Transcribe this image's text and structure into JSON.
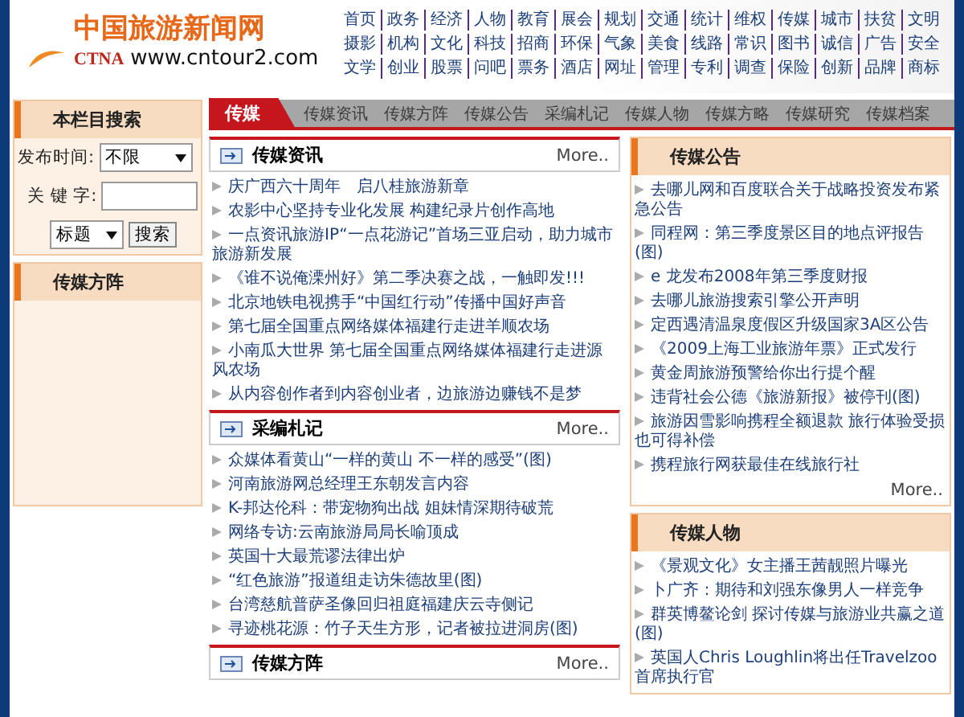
{
  "header": {
    "logo_title": "中国旅游新闻网",
    "logo_mark": "CTNA",
    "logo_url": "www.cntour2.com",
    "nav_rows": [
      [
        "首页",
        "政务",
        "经济",
        "人物",
        "教育",
        "展会",
        "规划",
        "交通",
        "统计",
        "维权",
        "传媒",
        "城市",
        "扶贫",
        "文明"
      ],
      [
        "摄影",
        "机构",
        "文化",
        "科技",
        "招商",
        "环保",
        "气象",
        "美食",
        "线路",
        "常识",
        "图书",
        "诚信",
        "广告",
        "安全"
      ],
      [
        "文学",
        "创业",
        "股票",
        "问吧",
        "票务",
        "酒店",
        "网址",
        "管理",
        "专利",
        "调查",
        "保险",
        "创新",
        "品牌",
        "商标"
      ]
    ]
  },
  "sidebar": {
    "search_title": "本栏目搜索",
    "date_label": "发布时间:",
    "date_value": "不限",
    "keyword_label": "关 键 字:",
    "field_value": "标题",
    "search_button": "搜索",
    "section_title": "传媒方阵"
  },
  "channel_bar": {
    "title": "传媒",
    "tabs": [
      "传媒资讯",
      "传媒方阵",
      "传媒公告",
      "采编札记",
      "传媒人物",
      "传媒方略",
      "传媒研究",
      "传媒档案"
    ]
  },
  "main_sections": [
    {
      "title": "传媒资讯",
      "more": "More..",
      "items": [
        "庆广西六十周年　启八桂旅游新章",
        "农影中心坚持专业化发展 构建纪录片创作高地",
        "一点资讯旅游IP“一点花游记”首场三亚启动，助力城市旅游新发展",
        "《谁不说俺溧州好》第二季决赛之战，一触即发!!!",
        "北京地铁电视携手“中国红行动”传播中国好声音",
        "第七届全国重点网络媒体福建行走进羊顺农场",
        "小南瓜大世界 第七届全国重点网络媒体福建行走进源风农场",
        "从内容创作者到内容创业者，边旅游边赚钱不是梦"
      ]
    },
    {
      "title": "采编札记",
      "more": "More..",
      "items": [
        "众媒体看黄山“一样的黄山 不一样的感受”(图)",
        "河南旅游网总经理王东朝发言内容",
        "K-邦达伦科：带宠物狗出战 姐妹情深期待破荒",
        "网络专访:云南旅游局局长喻顶成",
        "英国十大最荒谬法律出炉",
        "“红色旅游”报道组走访朱德故里(图)",
        "台湾慈航普萨圣像回归祖庭福建庆云寺侧记",
        "寻迹桃花源：竹子天生方形，记者被拉进洞房(图)"
      ]
    },
    {
      "title": "传媒方阵",
      "more": "More.."
    }
  ],
  "right_sections": [
    {
      "title": "传媒公告",
      "more": "More..",
      "items": [
        "去哪儿网和百度联合关于战略投资发布紧急公告",
        "同程网：第三季度景区目的地点评报告(图)",
        "e 龙发布2008年第三季度财报",
        "去哪儿旅游搜索引擎公开声明",
        "定西遇清温泉度假区升级国家3A区公告",
        "《2009上海工业旅游年票》正式发行",
        "黄金周旅游预警给你出行提个醒",
        "违背社会公德《旅游新报》被停刊(图)",
        "旅游因雪影响携程全额退款 旅行体验受损也可得补偿",
        "携程旅行网获最佳在线旅行社"
      ]
    },
    {
      "title": "传媒人物",
      "items": [
        "《景观文化》女主播王茜靓照片曝光",
        "卜广齐：期待和刘强东像男人一样竞争",
        "群英博鳌论剑 探讨传媒与旅游业共赢之道(图)",
        "英国人Chris Loughlin将出任Travelzoo首席执行官"
      ]
    }
  ]
}
